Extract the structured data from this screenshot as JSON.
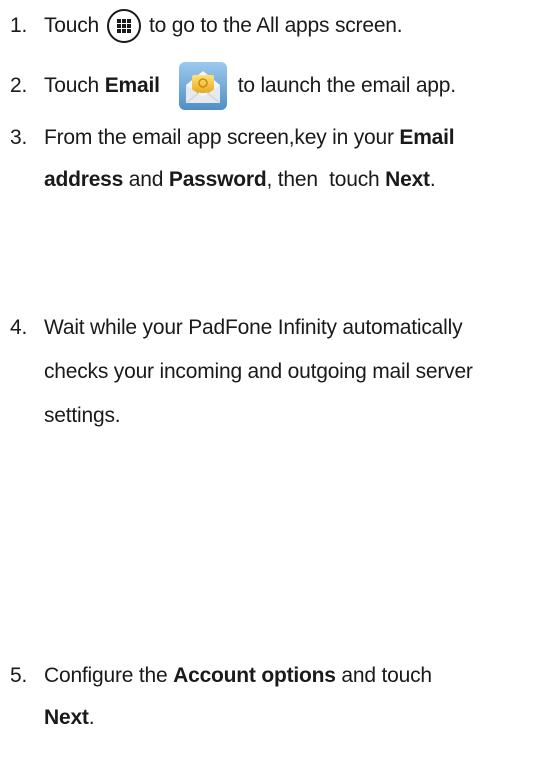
{
  "steps": [
    {
      "number": "1.",
      "pre": "Touch",
      "icon": "all-apps-icon",
      "post": "to go to the All apps screen."
    },
    {
      "number": "2.",
      "pre": "Touch",
      "bold": "Email",
      "icon": "email-app-icon",
      "post": "to launch the email app."
    },
    {
      "number": "3.",
      "line1_pre": "From the email app screen,key in your",
      "line1_bold": "Email",
      "line2_bold1": "address",
      "line2_mid": "and",
      "line2_bold2": "Password",
      "line2_post": ", then  touch",
      "line2_bold3": "Next",
      "line2_end": "."
    },
    {
      "number": "4.",
      "line1": "Wait while your PadFone Infinity automatically",
      "line2": "checks your incoming and outgoing mail server",
      "line3": "settings."
    },
    {
      "number": "5.",
      "line1_pre": "Configure the",
      "line1_bold": "Account options",
      "line1_post": "and touch",
      "line2_bold": "Next",
      "line2_end": "."
    }
  ],
  "colors": {
    "text": "#1a1a1a",
    "email_icon_bg": "#6ea9d8",
    "email_icon_envelope": "#f3c23a"
  }
}
